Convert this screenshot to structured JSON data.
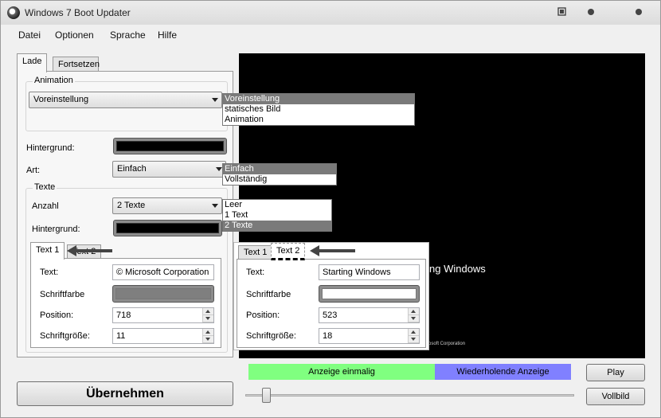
{
  "window": {
    "title": "Windows 7 Boot Updater"
  },
  "menu": [
    "Datei",
    "Optionen",
    "Sprache",
    "Hilfe"
  ],
  "tabs": [
    {
      "label": "Lade",
      "active": true
    },
    {
      "label": "Fortsetzen",
      "active": false
    }
  ],
  "animation": {
    "group_label": "Animation",
    "selected": "Voreinstellung",
    "options": [
      "Voreinstellung",
      "statisches Bild",
      "Animation"
    ]
  },
  "background": {
    "label": "Hintergrund:",
    "color": "#000000"
  },
  "type": {
    "label": "Art:",
    "selected": "Einfach",
    "options": [
      "Einfach",
      "Vollständig"
    ]
  },
  "texts": {
    "group_label": "Texte",
    "count_label": "Anzahl",
    "count_selected": "2 Texte",
    "count_options": [
      "Leer",
      "1 Text",
      "2 Texte"
    ],
    "background_label": "Hintergrund:",
    "background_color": "#000000"
  },
  "text1": {
    "tab_label": "Text 1",
    "other_tab_label": "Text 2",
    "text_label": "Text:",
    "text_value": "© Microsoft Corporation",
    "color_label": "Schriftfarbe",
    "color": "#7f7f7f",
    "position_label": "Position:",
    "position_value": "718",
    "size_label": "Schriftgröße:",
    "size_value": "11"
  },
  "text2": {
    "tab_label": "Text 1",
    "active_tab_label": "Text 2",
    "text_label": "Text:",
    "text_value": "Starting Windows",
    "color_label": "Schriftfarbe",
    "color": "#ffffff",
    "position_label": "Position:",
    "position_value": "523",
    "size_label": "Schriftgröße:",
    "size_value": "18"
  },
  "preview": {
    "text_visible": "ng Windows",
    "copyright_visible": "osoft Corporation"
  },
  "apply_button": "Übernehmen",
  "display_once": {
    "label": "Anzeige einmalig",
    "color": "#80ff80"
  },
  "display_repeat": {
    "label": "Wiederholende Anzeige",
    "color": "#8080ff"
  },
  "play_button": "Play",
  "fullscreen_button": "Vollbild",
  "slider": {
    "value": 0.05
  }
}
